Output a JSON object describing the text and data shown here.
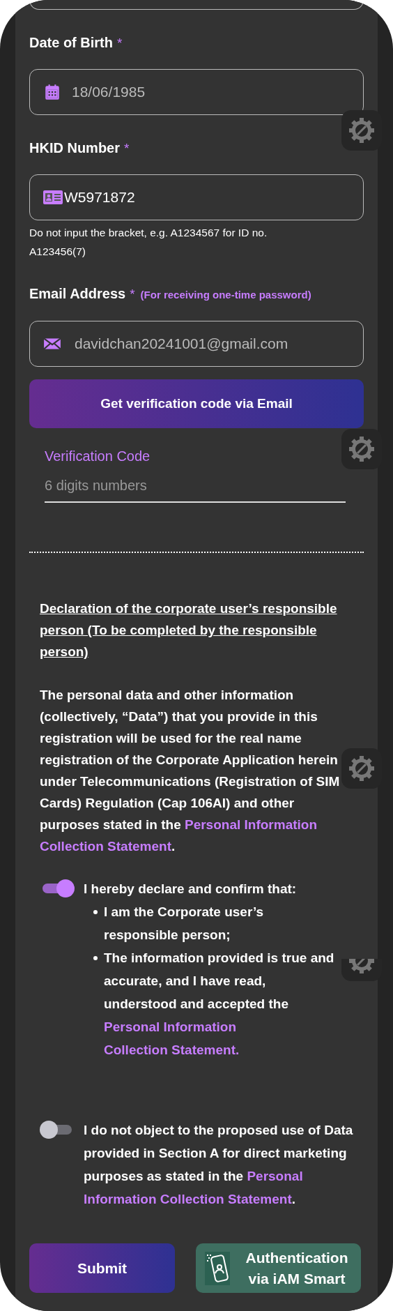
{
  "fields": [
    {
      "kind": "date",
      "label": "Date of Birth",
      "required_mark": "*",
      "value": "18/06/1985"
    },
    {
      "kind": "id",
      "label": "HKID Number",
      "required_mark": "*",
      "value": "W5971872",
      "hint": "Do not input the bracket, e.g. A1234567 for ID no. A123456(7)"
    },
    {
      "kind": "email",
      "label": "Email Address",
      "required_mark": "*",
      "note": "(For receiving one-time password)",
      "value": "davidchan20241001@gmail.com"
    }
  ],
  "verify_button": "Get verification code via Email",
  "verification_code": {
    "label": "Verification Code",
    "placeholder": "6 digits numbers"
  },
  "declaration": {
    "heading": "Declaration of the corporate user’s responsible person (To be completed by the responsible person)",
    "paragraph": {
      "before": "The personal data and other information (collectively, “Data”) that you provide in this registration will be used for the real name registration of the Corporate Application herein under Telecommunications (Registration of SIM Cards) Regulation (Cap 106AI) and other purposes stated in the ",
      "link": [
        "Personal Information",
        "Collection Statement"
      ],
      "after": "."
    }
  },
  "consents": [
    {
      "on": true,
      "intro": "I hereby declare and confirm that:",
      "bullets": [
        {
          "before": "I am the Corporate user’s responsible person;"
        },
        {
          "before": "The information provided is true and accurate, and I have read, understood and accepted the ",
          "link": [
            "Personal Information",
            "Collection Statement."
          ]
        }
      ]
    },
    {
      "on": false,
      "intro": "I do not object to the proposed use of Data provided in Section A for direct marketing purposes as stated in the ",
      "link": [
        "Personal",
        "Information Collection Statement"
      ],
      "after": "."
    }
  ],
  "buttons": [
    {
      "kind": "submit",
      "label": "Submit"
    },
    {
      "kind": "iam_smart",
      "label": "Authentication via iAM Smart"
    }
  ]
}
